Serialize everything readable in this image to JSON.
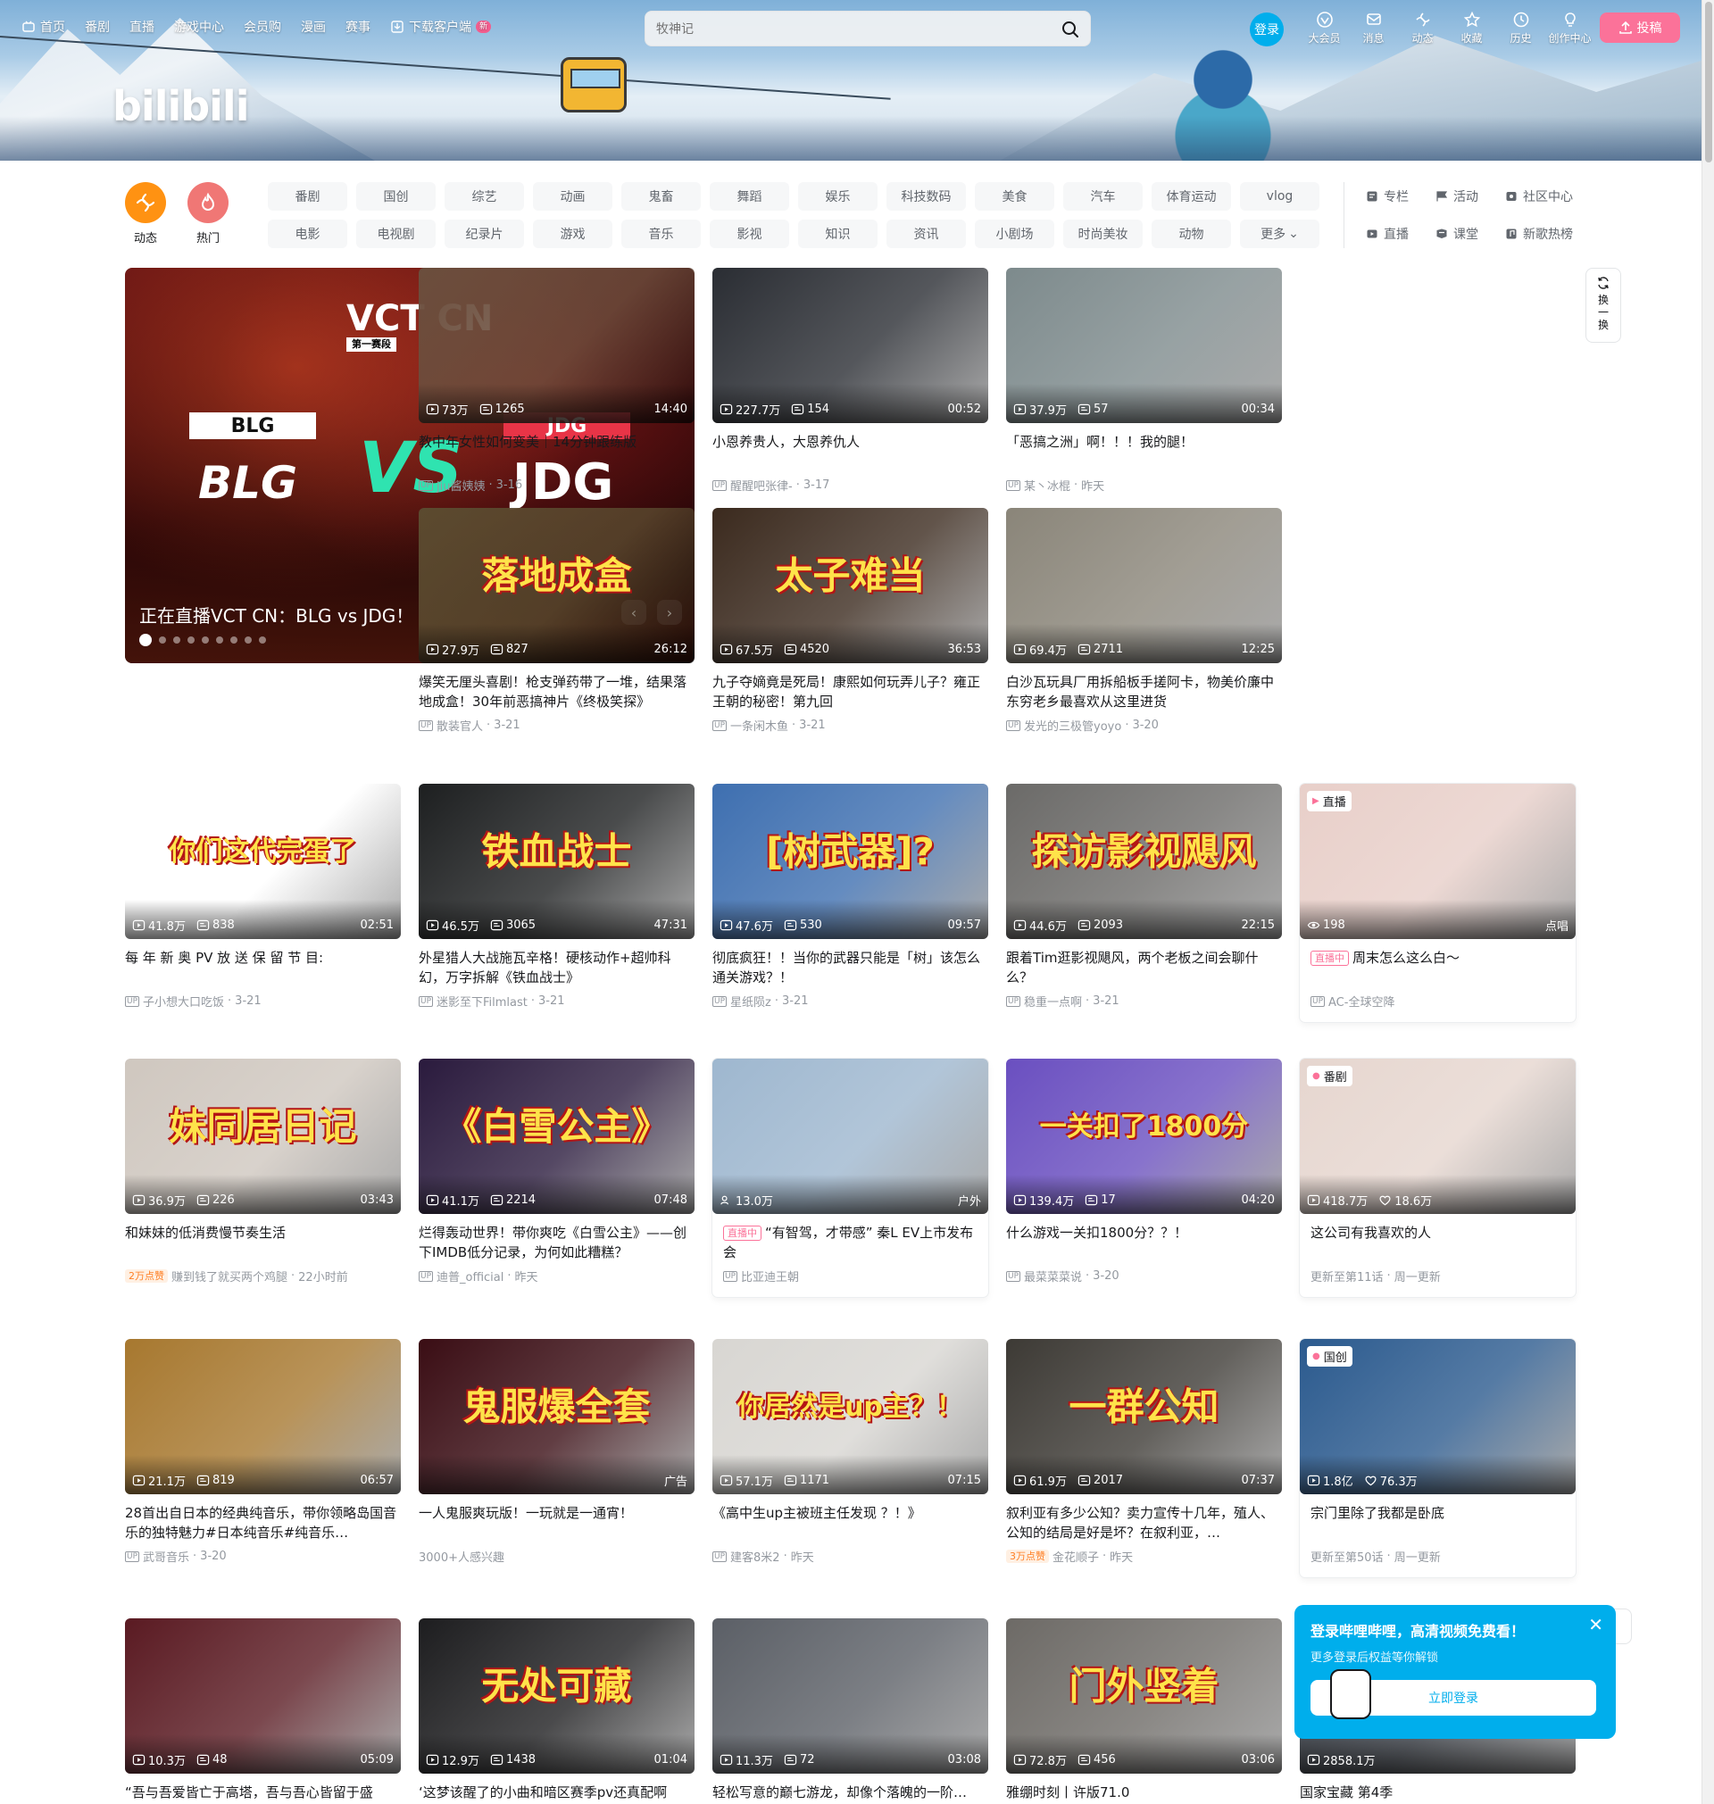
{
  "header": {
    "nav_left": [
      {
        "label": "首页",
        "icon": "tv-icon"
      },
      {
        "label": "番剧"
      },
      {
        "label": "直播"
      },
      {
        "label": "游戏中心"
      },
      {
        "label": "会员购"
      },
      {
        "label": "漫画"
      },
      {
        "label": "赛事"
      },
      {
        "label": "下载客户端",
        "icon": "download-icon",
        "badge": "新"
      }
    ],
    "search_placeholder": "牧神记",
    "login_label": "登录",
    "nav_right": [
      {
        "label": "大会员",
        "icon": "vip-icon"
      },
      {
        "label": "消息",
        "icon": "message-icon"
      },
      {
        "label": "动态",
        "icon": "dynamic-icon"
      },
      {
        "label": "收藏",
        "icon": "star-icon"
      },
      {
        "label": "历史",
        "icon": "history-icon"
      },
      {
        "label": "创作中心",
        "icon": "bulb-icon"
      }
    ],
    "upload_label": "投稿",
    "logo_text": "bilibili"
  },
  "channels": {
    "dynamic_label": "动态",
    "hot_label": "热门",
    "tags": [
      "番剧",
      "国创",
      "综艺",
      "动画",
      "鬼畜",
      "舞蹈",
      "娱乐",
      "科技数码",
      "美食",
      "汽车",
      "体育运动",
      "vlog",
      "电影",
      "电视剧",
      "纪录片",
      "游戏",
      "音乐",
      "影视",
      "知识",
      "资讯",
      "小剧场",
      "时尚美妆",
      "动物",
      "更多"
    ],
    "extras": [
      {
        "label": "专栏",
        "icon": "column-icon"
      },
      {
        "label": "活动",
        "icon": "flag-icon"
      },
      {
        "label": "社区中心",
        "icon": "community-icon"
      },
      {
        "label": "直播",
        "icon": "live-icon"
      },
      {
        "label": "课堂",
        "icon": "classroom-icon"
      },
      {
        "label": "新歌热榜",
        "icon": "music-chart-icon"
      }
    ]
  },
  "carousel": {
    "title": "正在直播VCT CN：BLG vs JDG！",
    "event": "VCT CN",
    "stage": "第一赛段",
    "team_a": "BLG",
    "team_b": "JDG",
    "vs": "VS",
    "dot_count": 9,
    "active_dot": 0
  },
  "refresh_label": "换一换",
  "cards": [
    {
      "title": "教中年女性如何变美｜14分钟跟练版",
      "views": "73万",
      "danmaku": "1265",
      "duration": "14:40",
      "author": "jiu酱姨姨",
      "date": "3-16",
      "bg": "#6b4e3d"
    },
    {
      "title": "小恩养贵人，大恩养仇人",
      "views": "227.7万",
      "danmaku": "154",
      "duration": "00:52",
      "author": "醒醒吧张律-",
      "date": "3-17",
      "bg": "#2a2d33"
    },
    {
      "title": "「恶搞之洲」啊！！！我的腿！",
      "views": "37.9万",
      "danmaku": "57",
      "duration": "00:34",
      "author": "某丶冰棍",
      "date": "昨天",
      "bg": "#7d8a8c"
    },
    {
      "title": "爆笑无厘头喜剧！枪支弹药带了一堆，结果落地成盒！30年前恶搞神片《终极笑探》",
      "views": "27.9万",
      "danmaku": "827",
      "duration": "26:12",
      "author": "散装官人",
      "date": "3-21",
      "bg": "#5b4a2f",
      "deco": "落地成盒"
    },
    {
      "title": "九子夺嫡竟是死局！康熙如何玩弄儿子？雍正王朝的秘密！第九回",
      "views": "67.5万",
      "danmaku": "4520",
      "duration": "36:53",
      "author": "一条闲木鱼",
      "date": "3-21",
      "bg": "#3b2a1e",
      "deco": "太子难当"
    },
    {
      "title": "白沙瓦玩具厂用拆船板手搓阿卡，物美价廉中东穷老乡最喜欢从这里进货",
      "views": "69.4万",
      "danmaku": "2711",
      "duration": "12:25",
      "author": "发光的三极管yoyo",
      "date": "3-20",
      "bg": "#8a8579"
    },
    {
      "title": "每 年 新 奥 PV 放 送 保 留 节 目:",
      "views": "41.8万",
      "danmaku": "838",
      "duration": "02:51",
      "author": "子小想大口吃饭",
      "date": "3-21",
      "bg": "#ffffff",
      "deco": "你们这代完蛋了"
    },
    {
      "title": "外星猎人大战施瓦辛格！硬核动作+超帅科幻，万字拆解《铁血战士》",
      "views": "46.5万",
      "danmaku": "3065",
      "duration": "47:31",
      "author": "迷影至下Filmlast",
      "date": "3-21",
      "bg": "#1d1f20",
      "deco": "铁血战士"
    },
    {
      "title": "彻底疯狂！！当你的武器只能是「树」该怎么通关游戏？！",
      "views": "47.6万",
      "danmaku": "530",
      "duration": "09:57",
      "author": "星纸陨z",
      "date": "3-21",
      "bg": "#3e6fb0",
      "deco": "[树武器]?"
    },
    {
      "title": "跟着Tim逛影视飓风，两个老板之间会聊什么？",
      "views": "44.6万",
      "danmaku": "2093",
      "duration": "22:15",
      "author": "稳重一点啊",
      "date": "3-21",
      "bg": "#6b6a68",
      "deco": "探访影视飓风"
    },
    {
      "title": "周末怎么这么白～",
      "live": true,
      "views": "198",
      "duration": "点唱",
      "author": "AC-全球空降",
      "tag": "直播",
      "bg": "#e8cfc9"
    },
    {
      "title": "和妹妹的低消费慢节奏生活",
      "views": "36.9万",
      "danmaku": "226",
      "duration": "03:43",
      "points": "2万点赞",
      "author": "赚到钱了就买两个鸡腿",
      "date": "22小时前",
      "bg": "#cfc7bf",
      "deco": "妹同居日记"
    },
    {
      "title": "烂得轰动世界！带你爽吃《白雪公主》——创下IMDB低分记录，为何如此糟糕？",
      "views": "41.1万",
      "danmaku": "2214",
      "duration": "07:48",
      "author": "迪普_official",
      "date": "昨天",
      "bg": "#2a1a3d",
      "deco": "《白雪公主》"
    },
    {
      "title": "“有智驾，才带感” 秦L EV上市发布会",
      "live": true,
      "views": "13.0万",
      "duration": "户外",
      "author": "比亚迪王朝",
      "bg": "#9eb7cf"
    },
    {
      "title": "什么游戏一关扣1800分？？！",
      "views": "139.4万",
      "danmaku": "17",
      "duration": "04:20",
      "author": "最菜菜菜说",
      "date": "3-20",
      "bg": "#6a4fc0",
      "deco": "一关扣了1800分"
    },
    {
      "title": "这公司有我喜欢的人",
      "views": "418.7万",
      "likes": "18.6万",
      "update": "更新至第11话",
      "freq": "周一更新",
      "tag": "番剧",
      "bg": "#e6d6cf"
    },
    {
      "title": "28首出自日本的经典纯音乐，带你领略岛国音乐的独特魅力#日本纯音乐#纯音乐…",
      "views": "21.1万",
      "danmaku": "819",
      "duration": "06:57",
      "author": "武哥音乐",
      "date": "3-20",
      "bg": "#a7782f"
    },
    {
      "title": "一人鬼服爽玩版！一玩就是一通宵！",
      "views": "",
      "danmaku": "",
      "duration": "广告",
      "interest": "3000+人感兴趣",
      "bg": "#3a0d14",
      "deco": "鬼服爆全套"
    },
    {
      "title": "《高中生up主被班主任发现 ？！》",
      "views": "57.1万",
      "danmaku": "1171",
      "duration": "07:15",
      "author": "建客8米2",
      "date": "昨天",
      "bg": "#d8d6d2",
      "deco": "你居然是up主？！"
    },
    {
      "title": "叙利亚有多少公知？卖力宣传十几年，殖人、公知的结局是好是坏？在叙利亚，…",
      "views": "61.9万",
      "danmaku": "2017",
      "duration": "07:37",
      "points": "3万点赞",
      "author": "金花顺子",
      "date": "昨天",
      "bg": "#3d3a35",
      "deco": "一群公知"
    },
    {
      "title": "宗门里除了我都是卧底",
      "views": "1.8亿",
      "likes": "76.3万",
      "update": "更新至第50话",
      "freq": "周一更新",
      "tag": "国创",
      "bg": "#2b5a8e"
    },
    {
      "title": "“吾与吾爱皆亡于高塔，吾与吾心皆留于盛",
      "views": "10.3万",
      "danmaku": "48",
      "duration": "05:09",
      "bg": "#5a1a22"
    },
    {
      "title": "‘这梦该醒了的小曲和暗区赛季pv还真配啊",
      "views": "12.9万",
      "danmaku": "1438",
      "duration": "01:04",
      "bg": "#1d1d1f",
      "deco": "无处可藏"
    },
    {
      "title": "轻松写意的巅七游龙，却像个落魄的一阶…",
      "views": "11.3万",
      "danmaku": "72",
      "duration": "03:08",
      "bg": "#5b5f66"
    },
    {
      "title": "雅绷时刻丨许版71.0",
      "views": "72.8万",
      "danmaku": "456",
      "duration": "03:06",
      "bg": "#6d6a66",
      "deco": "门外竖着"
    },
    {
      "title": "国家宝藏 第4季",
      "views": "2858.1万",
      "bg": "#3a3f47"
    }
  ],
  "login_popup": {
    "title": "登录哔哩哔哩，高清视频免费看！",
    "subtitle": "更多登录后权益等你解锁",
    "button": "立即登录"
  },
  "colors": {
    "brand_pink": "#fb7299",
    "brand_blue": "#00aeec",
    "dynamic_orange": "#ff9212",
    "hot_red": "#f07775"
  }
}
